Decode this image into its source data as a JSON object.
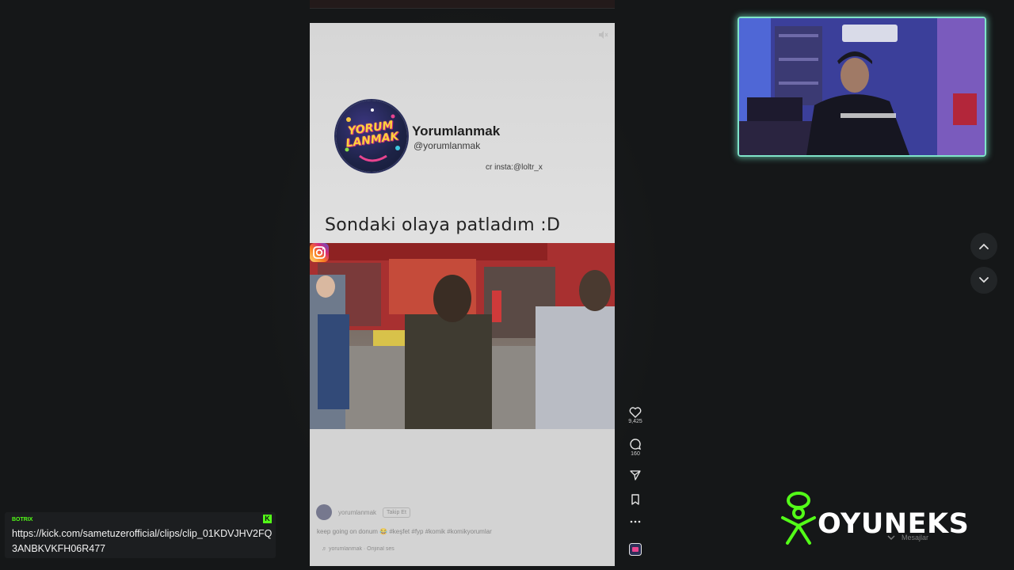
{
  "post": {
    "brand_name": "Yorumlanmak",
    "brand_handle": "@yorumlanmak",
    "logo_text_line1": "YORUM",
    "logo_text_line2": "LANMAK",
    "credit": "cr insta:@loltr_x",
    "caption": "Sondaki olaya patladım :D",
    "meta_user": "yorumlanmak",
    "follow_label": "Takip Et",
    "description": "keep going on donum 😂 #keşfet #fyp #komik #komikyorumlar",
    "sound": "♬ yorumlanmak · Orijinal ses"
  },
  "actions": {
    "likes": "9,425",
    "comments": "160"
  },
  "chat": {
    "bot_name": "BOTRIX",
    "message": "https://kick.com/sametuzerofficial/clips/clip_01KDVJHV2FQ3ANBKVKFH06R477"
  },
  "overlay": {
    "brand": "OYUNEKS",
    "messages_label": "Mesajlar"
  },
  "colors": {
    "webcam_border": "#7fe4c9",
    "kick_green": "#53fc18",
    "brand_green": "#53fc18"
  }
}
